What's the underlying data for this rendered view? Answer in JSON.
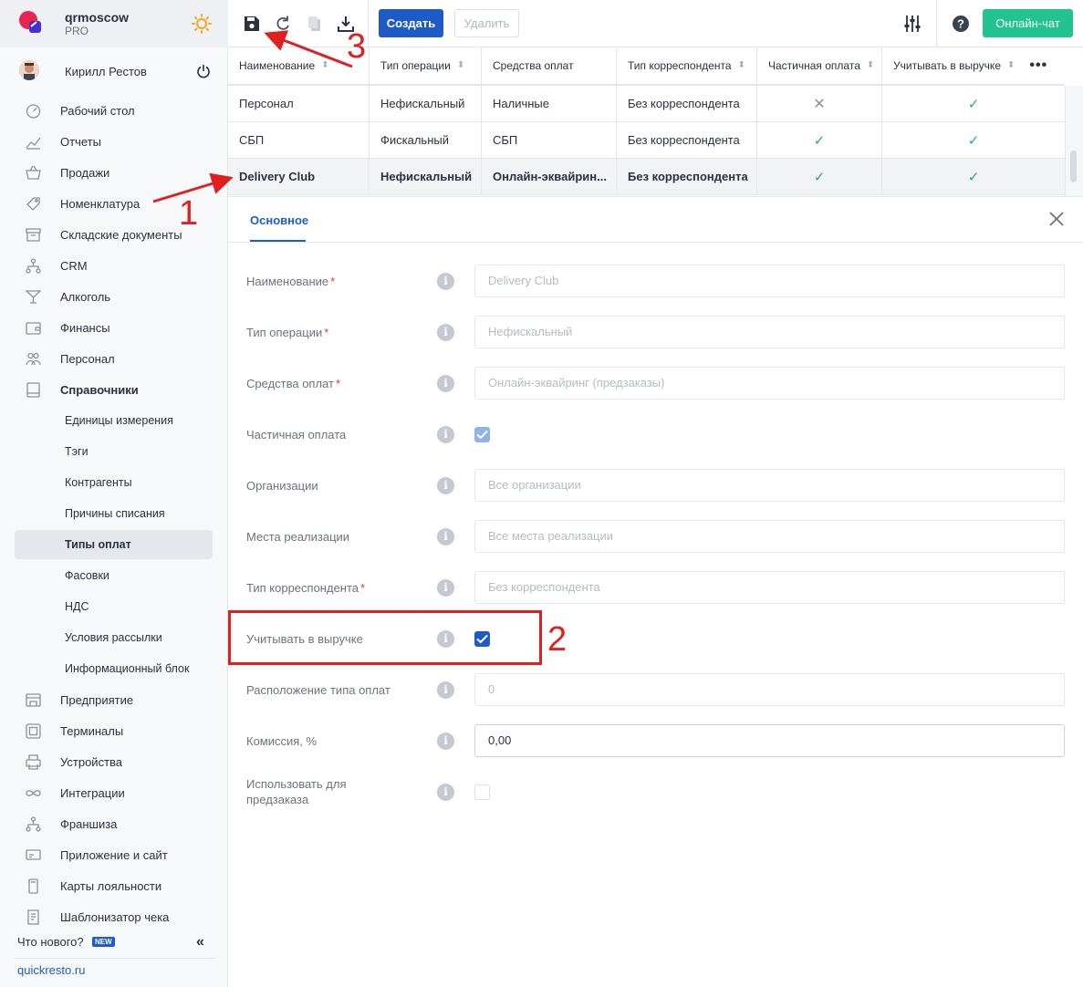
{
  "brand": {
    "name": "qrmoscow",
    "plan": "PRO"
  },
  "user": {
    "name": "Кирилл Рестов"
  },
  "nav": [
    {
      "label": "Рабочий стол",
      "icon": "dashboard-icon"
    },
    {
      "label": "Отчеты",
      "icon": "chart-icon"
    },
    {
      "label": "Продажи",
      "icon": "basket-icon"
    },
    {
      "label": "Номенклатура",
      "icon": "tag-icon"
    },
    {
      "label": "Складские документы",
      "icon": "archive-icon"
    },
    {
      "label": "CRM",
      "icon": "hierarchy-icon"
    },
    {
      "label": "Алкоголь",
      "icon": "cocktail-icon"
    },
    {
      "label": "Финансы",
      "icon": "wallet-icon"
    },
    {
      "label": "Персонал",
      "icon": "people-icon"
    },
    {
      "label": "Справочники",
      "icon": "book-icon"
    }
  ],
  "subnav": [
    {
      "label": "Единицы измерения"
    },
    {
      "label": "Тэги"
    },
    {
      "label": "Контрагенты"
    },
    {
      "label": "Причины списания"
    },
    {
      "label": "Типы оплат"
    },
    {
      "label": "Фасовки"
    },
    {
      "label": "НДС"
    },
    {
      "label": "Условия рассылки"
    },
    {
      "label": "Информационный блок"
    }
  ],
  "nav2": [
    {
      "label": "Предприятие",
      "icon": "store-icon"
    },
    {
      "label": "Терминалы",
      "icon": "qr-icon"
    },
    {
      "label": "Устройства",
      "icon": "printer-icon"
    },
    {
      "label": "Интеграции",
      "icon": "infinity-icon"
    },
    {
      "label": "Франшиза",
      "icon": "hierarchy-icon"
    },
    {
      "label": "Приложение и сайт",
      "icon": "app-icon"
    },
    {
      "label": "Карты лояльности",
      "icon": "card-icon"
    },
    {
      "label": "Шаблонизатор чека",
      "icon": "receipt-icon"
    }
  ],
  "footer": {
    "whats_new": "Что нового?",
    "new_badge": "NEW",
    "site": "quickresto.ru"
  },
  "toolbar": {
    "create": "Создать",
    "delete": "Удалить",
    "chat": "Онлайн-чат"
  },
  "table": {
    "headers": [
      "Наименование",
      "Тип операции",
      "Средства оплат",
      "Тип корреспондента",
      "Частичная оплата",
      "Учитывать в выручке"
    ],
    "rows": [
      {
        "name": "Персонал",
        "op": "Нефискальный",
        "means": "Наличные",
        "corr": "Без корреспондента",
        "partial": false,
        "revenue": true
      },
      {
        "name": "СБП",
        "op": "Фискальный",
        "means": "СБП",
        "corr": "Без корреспондента",
        "partial": true,
        "revenue": true
      },
      {
        "name": "Delivery Club",
        "op": "Нефискальный",
        "means": "Онлайн-эквайрин...",
        "corr": "Без корреспондента",
        "partial": true,
        "revenue": true
      }
    ]
  },
  "form": {
    "tab": "Основное",
    "fields": [
      {
        "label": "Наименование",
        "required": true,
        "value": "Delivery Club"
      },
      {
        "label": "Тип операции",
        "required": true,
        "value": "Нефискальный"
      },
      {
        "label": "Средства оплат",
        "required": true,
        "value": "Онлайн-эквайринг (предзаказы)"
      },
      {
        "label": "Частичная оплата",
        "checked": true
      },
      {
        "label": "Организации",
        "value": "Все организации"
      },
      {
        "label": "Места реализации",
        "value": "Все места реализации"
      },
      {
        "label": "Тип корреспондента",
        "required": true,
        "value": "Без корреспондента"
      },
      {
        "label": "Учитывать в выручке",
        "checked": true
      },
      {
        "label": "Расположение типа оплат",
        "value": "0"
      },
      {
        "label": "Комиссия, %",
        "value": "0,00"
      },
      {
        "label": "Использовать для предзаказа",
        "checked": false
      }
    ]
  },
  "annotations": {
    "n1": "1",
    "n2": "2",
    "n3": "3"
  },
  "colors": {
    "primary": "#1f5bc7",
    "chat": "#22c38e",
    "annotation": "#e02020",
    "check": "#22b07d"
  }
}
